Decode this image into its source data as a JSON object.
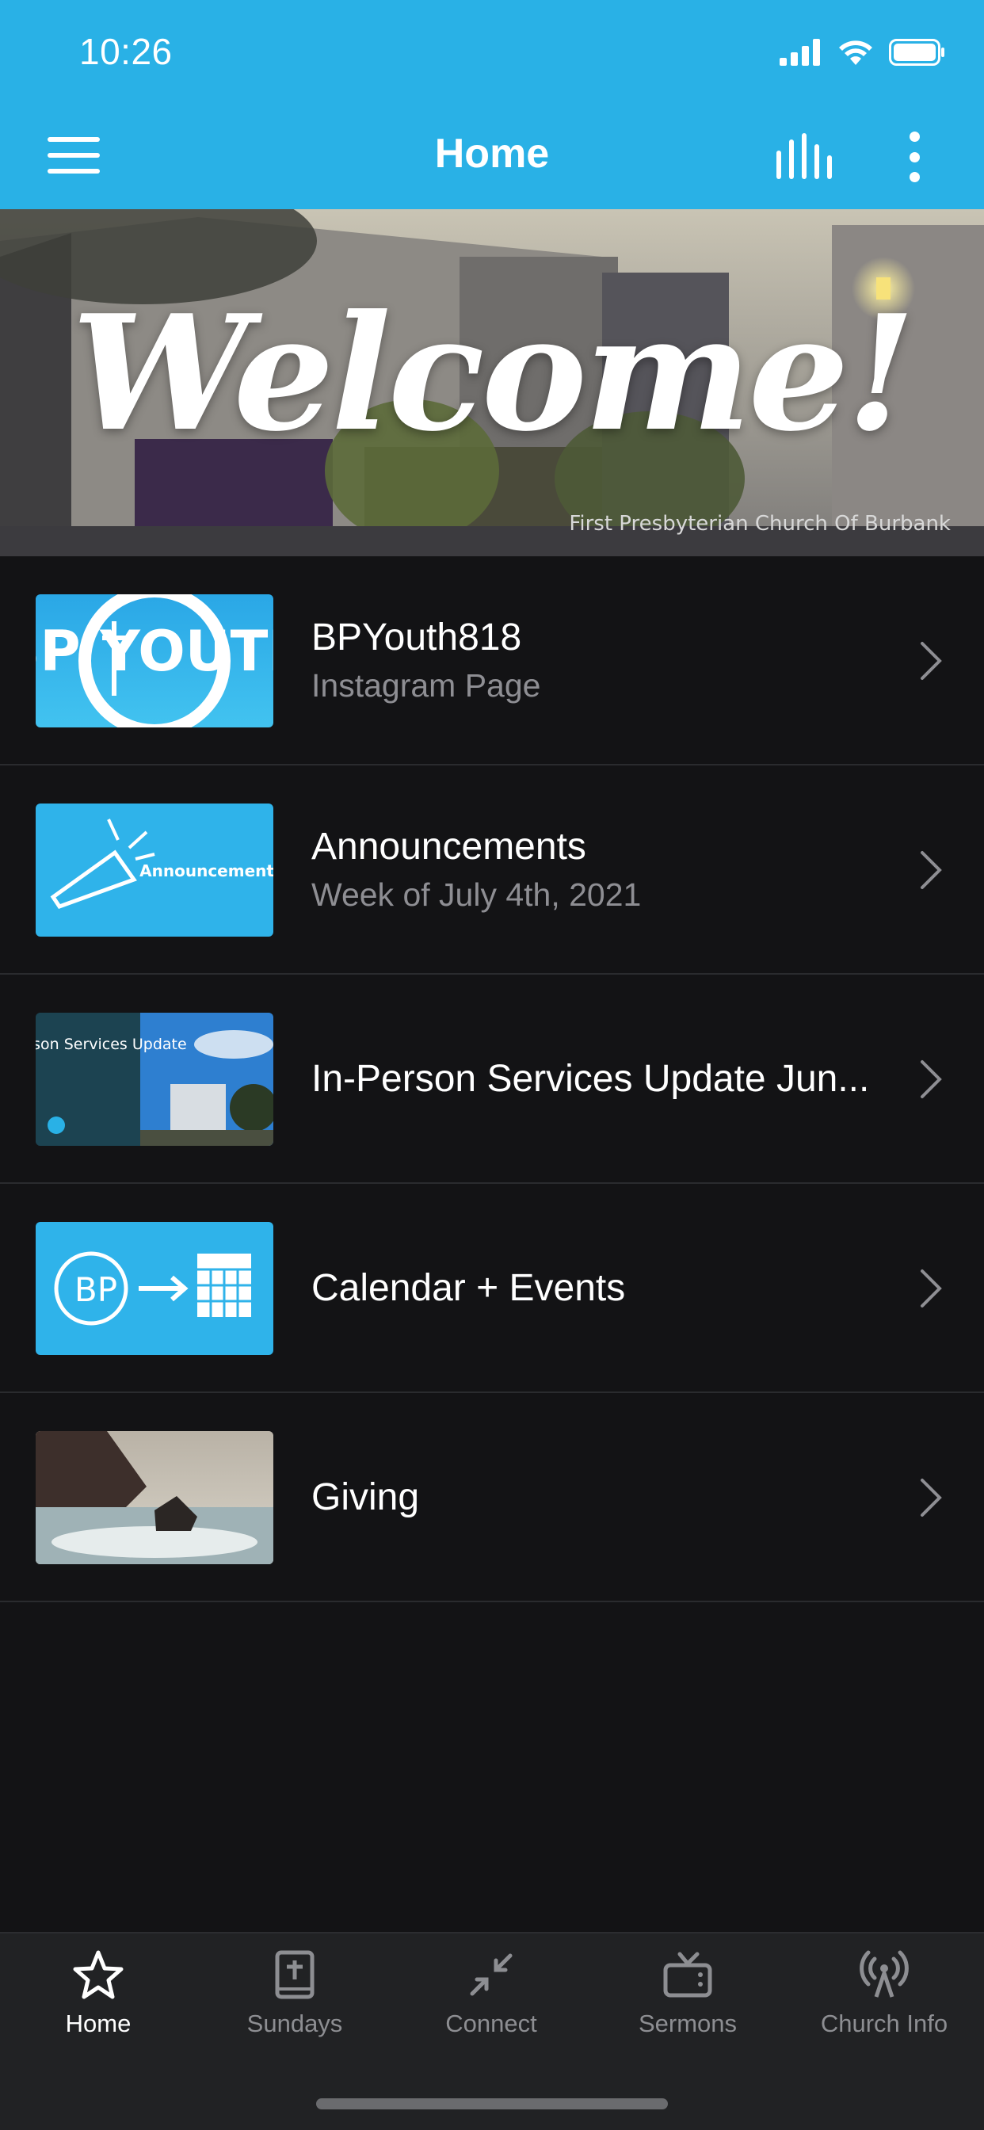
{
  "status": {
    "time": "10:26"
  },
  "nav": {
    "title": "Home"
  },
  "hero": {
    "title": "Welcome!",
    "sign_text": "First Presbyterian Church Of Burbank"
  },
  "list": [
    {
      "title": "BPYouth818",
      "subtitle": "Instagram Page",
      "thumb_text": "BP YOUTH"
    },
    {
      "title": "Announcements",
      "subtitle": "Week of July 4th, 2021",
      "thumb_text": "Announcements"
    },
    {
      "title": "In-Person Services Update Jun...",
      "subtitle": "",
      "thumb_text": "In-Person Services Update"
    },
    {
      "title": "Calendar + Events",
      "subtitle": "",
      "thumb_text": "BP"
    },
    {
      "title": "Giving",
      "subtitle": ""
    }
  ],
  "tabs": [
    {
      "label": "Home",
      "icon": "star-icon",
      "active": true
    },
    {
      "label": "Sundays",
      "icon": "bible-icon"
    },
    {
      "label": "Connect",
      "icon": "arrows-in-icon"
    },
    {
      "label": "Sermons",
      "icon": "tv-icon"
    },
    {
      "label": "Church Info",
      "icon": "broadcast-icon"
    }
  ],
  "colors": {
    "brand": "#29b1e6",
    "background": "#131315",
    "tabbar": "#212224",
    "muted": "#8e8e93"
  }
}
